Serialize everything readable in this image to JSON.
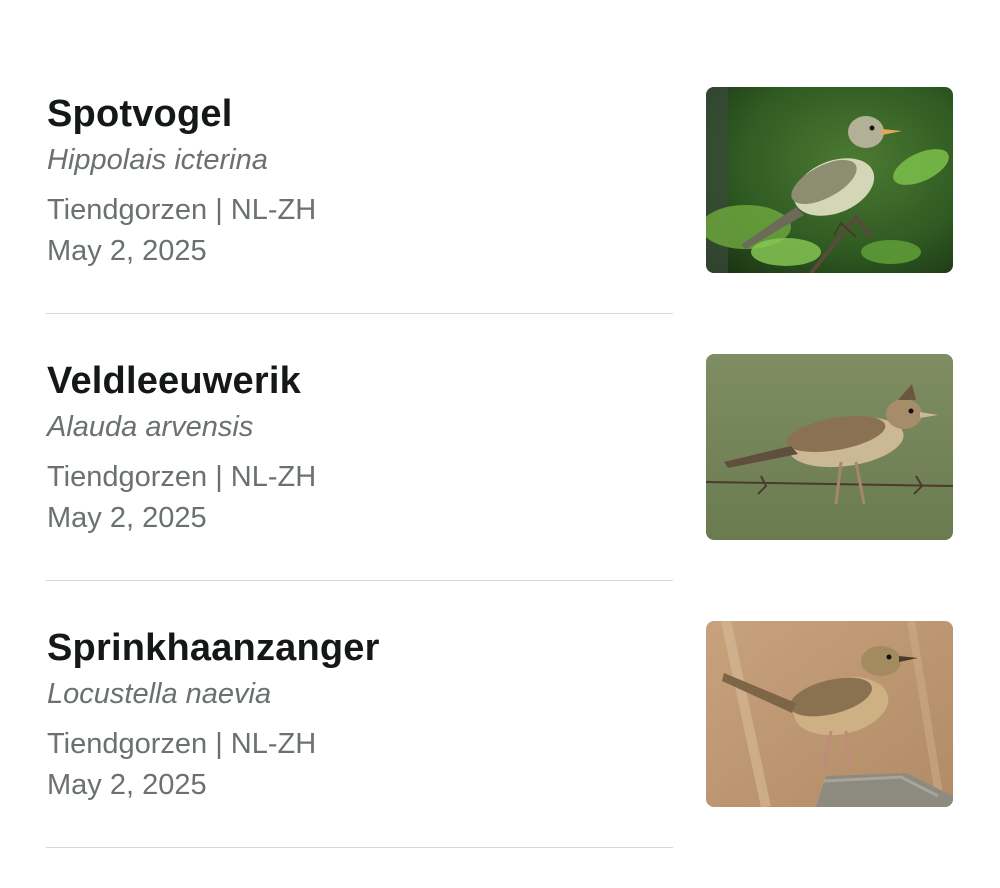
{
  "sightings": [
    {
      "common_name": "Spotvogel",
      "scientific_name": "Hippolais icterina",
      "location": "Tiendgorzen | NL-ZH",
      "date": "May 2, 2025",
      "photo_icon": "bird-photo-spotvogel"
    },
    {
      "common_name": "Veldleeuwerik",
      "scientific_name": "Alauda arvensis",
      "location": "Tiendgorzen | NL-ZH",
      "date": "May 2, 2025",
      "photo_icon": "bird-photo-veldleeuwerik"
    },
    {
      "common_name": "Sprinkhaanzanger",
      "scientific_name": "Locustella naevia",
      "location": "Tiendgorzen | NL-ZH",
      "date": "May 2, 2025",
      "photo_icon": "bird-photo-sprinkhaanzanger"
    }
  ],
  "colors": {
    "divider": "#d6d8d8",
    "secondary_text": "#6a7170",
    "primary_text": "#141817"
  }
}
